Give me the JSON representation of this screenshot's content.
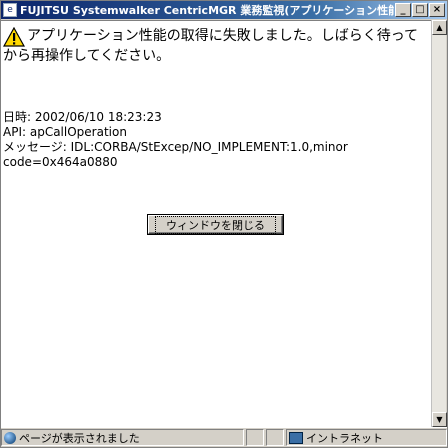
{
  "window": {
    "title": "FUJITSU Systemwalker CentricMGR 業務監視(アプリケーション性能) -",
    "buttons": {
      "minimize": "_",
      "maximize": "□",
      "close": "×"
    }
  },
  "message": {
    "line1": "アプリケーション性能の取得に失敗しました。しばらく待って",
    "line2": "から再操作してください。"
  },
  "details": {
    "datetime": "日時: 2002/06/10 18:23:23",
    "api": "API: apCallOperation",
    "message_line1": "メッセージ: IDL:CORBA/StExcep/NO_IMPLEMENT:1.0,minor",
    "message_line2": "code=0x464a0880"
  },
  "close_button": {
    "label": "ウィンドウを閉じる"
  },
  "statusbar": {
    "text": "ページが表示されました",
    "zone": "イントラネット"
  }
}
